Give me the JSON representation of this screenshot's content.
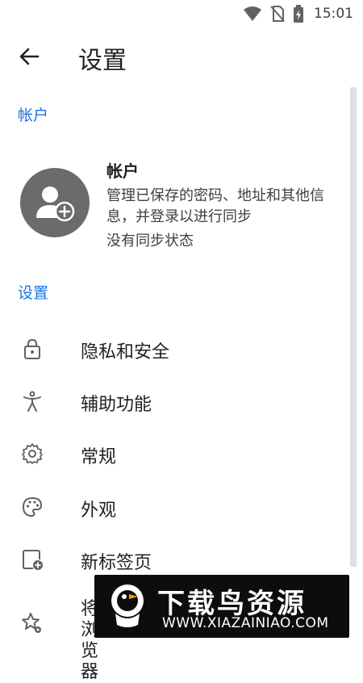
{
  "status_bar": {
    "time": "15:01",
    "icons": [
      "wifi-icon",
      "no-sim-icon",
      "battery-charging-icon"
    ]
  },
  "app_bar": {
    "back_icon": "arrow-left-icon",
    "title": "设置"
  },
  "sections": {
    "account_header": "帐户",
    "settings_header": "设置"
  },
  "account": {
    "avatar_icon": "person-add-icon",
    "title": "帐户",
    "description": "管理已保存的密码、地址和其他信息，并登录以进行同步",
    "status": "没有同步状态"
  },
  "settings_items": [
    {
      "icon": "lock-icon",
      "label": "隐私和安全"
    },
    {
      "icon": "accessibility-icon",
      "label": "辅助功能"
    },
    {
      "icon": "gear-icon",
      "label": "常规"
    },
    {
      "icon": "palette-icon",
      "label": "外观"
    },
    {
      "icon": "new-tab-icon",
      "label": "新标签页"
    },
    {
      "icon": "star-gear-icon",
      "label": "将 浏览器"
    }
  ],
  "watermark": {
    "title": "下载鸟资源",
    "url": "WWW.XIAZAINIAO.COM"
  },
  "colors": {
    "accent": "#1a73e8",
    "text_primary": "#202124",
    "text_secondary": "#3c4043",
    "icon": "#5f6368",
    "avatar_bg": "#6b6b6b",
    "watermark_bg": "#0d0d0d"
  }
}
